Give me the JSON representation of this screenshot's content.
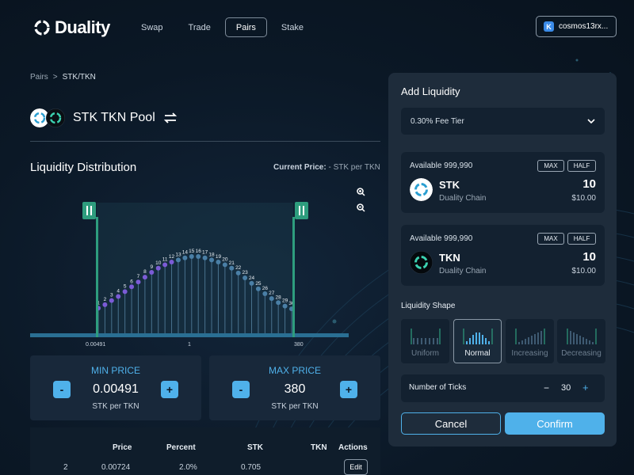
{
  "brand": {
    "name": "Duality"
  },
  "nav": {
    "items": [
      "Swap",
      "Trade",
      "Pairs",
      "Stake"
    ],
    "active": "Pairs"
  },
  "wallet": {
    "badge": "K",
    "address": "cosmos13rx..."
  },
  "breadcrumb": {
    "root": "Pairs",
    "separator": ">",
    "current": "STK/TKN"
  },
  "pool": {
    "title": "STK TKN Pool"
  },
  "distribution": {
    "title": "Liquidity Distribution",
    "current_price_label": "Current Price:",
    "current_price_value": "- STK per TKN",
    "axis_labels": [
      "0.00491",
      "1",
      "380"
    ]
  },
  "chart_data": {
    "type": "scatter",
    "ticks": [
      "1",
      "2",
      "3",
      "4",
      "5",
      "6",
      "7",
      "8",
      "9",
      "10",
      "11",
      "12",
      "13",
      "14",
      "15",
      "16",
      "17",
      "18",
      "19",
      "20",
      "21",
      "22",
      "23",
      "24",
      "25",
      "26",
      "27",
      "28",
      "29",
      "30"
    ],
    "values": [
      0.25,
      0.3,
      0.36,
      0.42,
      0.49,
      0.56,
      0.63,
      0.7,
      0.77,
      0.83,
      0.88,
      0.92,
      0.95,
      0.98,
      1.0,
      1.0,
      0.98,
      0.95,
      0.92,
      0.88,
      0.83,
      0.76,
      0.69,
      0.61,
      0.53,
      0.46,
      0.39,
      0.33,
      0.28,
      0.24
    ],
    "highlight_count": 12,
    "xlim": [
      0.00491,
      380
    ],
    "range_min": "0.00491",
    "range_max": "380"
  },
  "min_price": {
    "label": "MIN PRICE",
    "value": "0.00491",
    "unit": "STK per TKN",
    "minus": "-",
    "plus": "+"
  },
  "max_price": {
    "label": "MAX PRICE",
    "value": "380",
    "unit": "STK per TKN",
    "minus": "-",
    "plus": "+"
  },
  "table": {
    "headers": [
      "Price",
      "Percent",
      "STK",
      "TKN",
      "Actions"
    ],
    "rows": [
      {
        "index": "2",
        "price": "0.00724",
        "percent": "2.0%",
        "stk": "0.705",
        "tkn": "",
        "action": "Edit"
      }
    ]
  },
  "panel": {
    "title": "Add Liquidity",
    "fee_tier": "0.30% Fee Tier",
    "tokens": [
      {
        "available": "Available 999,990",
        "max": "MAX",
        "half": "HALF",
        "symbol": "STK",
        "chain": "Duality Chain",
        "amount": "10",
        "usd": "$10.00"
      },
      {
        "available": "Available 999,990",
        "max": "MAX",
        "half": "HALF",
        "symbol": "TKN",
        "chain": "Duality Chain",
        "amount": "10",
        "usd": "$10.00"
      }
    ],
    "shape_label": "Liquidity Shape",
    "shapes": [
      "Uniform",
      "Normal",
      "Increasing",
      "Decreasing"
    ],
    "selected_shape": "Normal",
    "ticks_label": "Number of Ticks",
    "ticks_value": "30",
    "ticks_minus": "−",
    "ticks_plus": "+",
    "cancel": "Cancel",
    "confirm": "Confirm"
  },
  "colors": {
    "accent": "#4fb1ea",
    "range": "#2e9d7e",
    "dot_highlight": "#7b5bd6",
    "dot_normal": "#4a7fa6",
    "panel": "#1e2c3b"
  }
}
